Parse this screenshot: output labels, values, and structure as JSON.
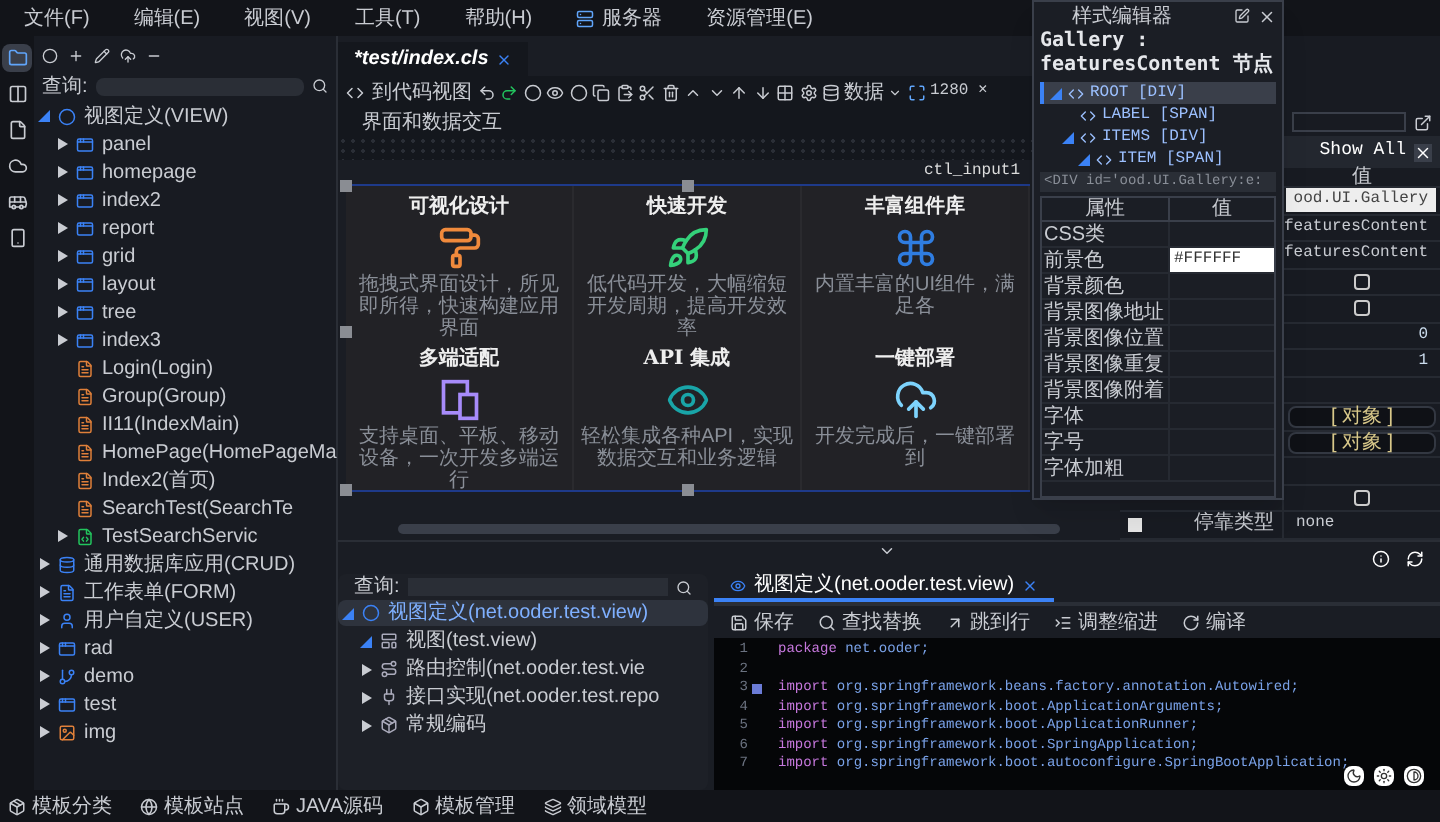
{
  "menu": [
    {
      "label": "文件(F)",
      "has_icon": false
    },
    {
      "label": "编辑(E)",
      "has_icon": false
    },
    {
      "label": "视图(V)",
      "has_icon": false
    },
    {
      "label": "工具(T)",
      "has_icon": false
    },
    {
      "label": "帮助(H)",
      "has_icon": false
    },
    {
      "label": "服务器",
      "has_icon": true
    },
    {
      "label": "资源管理(E)",
      "has_icon": false
    }
  ],
  "rail": [
    {
      "kind": "folder",
      "selected": true
    },
    {
      "kind": "columns",
      "selected": false
    },
    {
      "kind": "page",
      "selected": false
    },
    {
      "kind": "cloud",
      "selected": false
    },
    {
      "kind": "bus",
      "selected": false
    },
    {
      "kind": "phone",
      "selected": false
    }
  ],
  "project_tree": {
    "search_label": "查询:",
    "items": [
      {
        "label": "视图定义(VIEW)",
        "kind": "root",
        "expanded": true,
        "children": [
          {
            "label": "panel",
            "kind": "view",
            "expanded": false
          },
          {
            "label": "homepage",
            "kind": "view",
            "expanded": false
          },
          {
            "label": "index2",
            "kind": "view",
            "expanded": false
          },
          {
            "label": "report",
            "kind": "view",
            "expanded": false
          },
          {
            "label": "grid",
            "kind": "view",
            "expanded": false
          },
          {
            "label": "layout",
            "kind": "view",
            "expanded": false
          },
          {
            "label": "tree",
            "kind": "view",
            "expanded": false
          },
          {
            "label": "index3",
            "kind": "view",
            "expanded": false
          },
          {
            "label": "Login(Login)",
            "kind": "page"
          },
          {
            "label": "Group(Group)",
            "kind": "page"
          },
          {
            "label": "II11(IndexMain)",
            "kind": "page"
          },
          {
            "label": "HomePage(HomePageMa",
            "kind": "page"
          },
          {
            "label": "Index2(首页)",
            "kind": "page"
          },
          {
            "label": "SearchTest(SearchTe",
            "kind": "page"
          },
          {
            "label": "TestSearchServic",
            "kind": "service",
            "expanded": false
          }
        ]
      },
      {
        "label": "通用数据库应用(CRUD)",
        "kind": "db",
        "expanded": false
      },
      {
        "label": "工作表单(FORM)",
        "kind": "form",
        "expanded": false
      },
      {
        "label": "用户自定义(USER)",
        "kind": "user",
        "expanded": false
      },
      {
        "label": "rad",
        "kind": "view",
        "expanded": false
      },
      {
        "label": "demo",
        "kind": "branch",
        "expanded": false
      },
      {
        "label": "test",
        "kind": "view",
        "expanded": false
      },
      {
        "label": "img",
        "kind": "image",
        "expanded": false
      }
    ]
  },
  "editor": {
    "tab": {
      "label": "*test/index.cls",
      "selected": true
    },
    "code_view_button": "到代码视图",
    "data_button": "数据",
    "size": "1280 ×",
    "section_label": "界面和数据交互",
    "control_label": "ctl_input1",
    "cards": [
      {
        "kind": "roller",
        "title": "可视化设计",
        "description": "拖拽式界面设计，所见即所得，快速构建应用界面"
      },
      {
        "kind": "rocket",
        "title": "快速开发",
        "description": "低代码开发，大幅缩短开发周期，提高开发效率"
      },
      {
        "kind": "command",
        "title": "丰富组件库",
        "description": "内置丰富的UI组件，满足各"
      },
      {
        "kind": "devices",
        "title": "多端适配",
        "description": "支持桌面、平板、移动设备，一次开发多端运行"
      },
      {
        "kind": "eye",
        "title": "API 集成",
        "description": "轻松集成各种API，实现数据交互和业务逻辑"
      },
      {
        "kind": "cloud",
        "title": "一键部署",
        "description": "开发完成后，一键部署到"
      }
    ]
  },
  "properties": {
    "show_all": "Show All",
    "value_header": "值",
    "rows": [
      {
        "kind": "field",
        "value": "ood.UI.Gallery"
      },
      {
        "kind": "text",
        "value": "featuresContent"
      },
      {
        "kind": "text",
        "value": "featuresContent"
      },
      {
        "kind": "checkbox",
        "checked": false
      },
      {
        "kind": "checkbox",
        "checked": false
      },
      {
        "kind": "number",
        "value": "0"
      },
      {
        "kind": "number",
        "value": "1"
      },
      {
        "kind": "blank"
      },
      {
        "kind": "object",
        "value": "[ 对象 ]"
      },
      {
        "kind": "object",
        "value": "[ 对象 ]"
      },
      {
        "kind": "blank"
      },
      {
        "kind": "checkbox",
        "checked": false
      },
      {
        "kind": "text",
        "name": "停靠类型",
        "value": "none",
        "marked": false
      }
    ]
  },
  "style_editor": {
    "title": "样式编辑器",
    "node": "Gallery : featuresContent 节点",
    "tree": [
      {
        "label": "ROOT [DIV]",
        "selected": true,
        "expanded": true,
        "children": [
          {
            "label": "LABEL [SPAN]",
            "selected": false
          },
          {
            "label": "ITEMS [DIV]",
            "selected": false,
            "expanded": true,
            "children": [
              {
                "label": "ITEM [SPAN]",
                "selected": false,
                "expanded": true
              }
            ]
          }
        ]
      }
    ],
    "html": "<DIV id='ood.UI.Gallery:e:",
    "columns": [
      "属性",
      "值"
    ],
    "rows": [
      {
        "name": "CSS类"
      },
      {
        "name": "前景色",
        "value": "#FFFFFF"
      },
      {
        "name": "背景颜色"
      },
      {
        "name": "背景图像地址"
      },
      {
        "name": "背景图像位置"
      },
      {
        "name": "背景图像重复"
      },
      {
        "name": "背景图像附着"
      },
      {
        "name": "字体"
      },
      {
        "name": "字号"
      },
      {
        "name": "字体加粗"
      }
    ]
  },
  "class_tree": {
    "search_label": "查询:",
    "items": [
      {
        "label": "视图定义(net.ooder.test.view)",
        "kind": "circle",
        "selected": true,
        "expanded": true,
        "children": [
          {
            "label": "视图(test.view)",
            "kind": "layout",
            "selected": false,
            "expanded": true
          },
          {
            "label": "路由控制(net.ooder.test.vie",
            "kind": "route",
            "selected": false,
            "expanded": false
          },
          {
            "label": "接口实现(net.ooder.test.repo",
            "kind": "api",
            "selected": false,
            "expanded": false
          },
          {
            "label": "常规编码",
            "kind": "package",
            "selected": false,
            "expanded": false
          }
        ]
      }
    ]
  },
  "code_editor": {
    "tab": {
      "label": "视图定义(net.ooder.test.view)",
      "selected": true
    },
    "toolbar": [
      {
        "kind": "save",
        "label": "保存"
      },
      {
        "kind": "search",
        "label": "查找替换"
      },
      {
        "kind": "jump",
        "label": "跳到行"
      },
      {
        "kind": "indent",
        "label": "调整缩进"
      },
      {
        "kind": "compile",
        "label": "编译"
      }
    ],
    "lines": [
      {
        "number": "1",
        "keyword": "package",
        "text": "net.ooder;",
        "fold": false
      },
      {
        "number": "2",
        "fold": false
      },
      {
        "number": "3",
        "keyword": "import",
        "text": "org.springframework.beans.factory.annotation.Autowired;",
        "fold": true
      },
      {
        "number": "4",
        "keyword": "import",
        "text": "org.springframework.boot.ApplicationArguments;",
        "fold": false
      },
      {
        "number": "5",
        "keyword": "import",
        "text": "org.springframework.boot.ApplicationRunner;",
        "fold": false
      },
      {
        "number": "6",
        "keyword": "import",
        "text": "org.springframework.boot.SpringApplication;",
        "fold": false
      },
      {
        "number": "7",
        "keyword": "import",
        "text": "org.springframework.boot.autoconfigure.SpringBootApplication;",
        "fold": false
      }
    ]
  },
  "status_bar": [
    {
      "kind": "package",
      "label": "模板分类"
    },
    {
      "kind": "globe",
      "label": "模板站点"
    },
    {
      "kind": "java",
      "label": "JAVA源码"
    },
    {
      "kind": "box",
      "label": "模板管理"
    },
    {
      "kind": "layers",
      "label": "领域模型"
    }
  ]
}
